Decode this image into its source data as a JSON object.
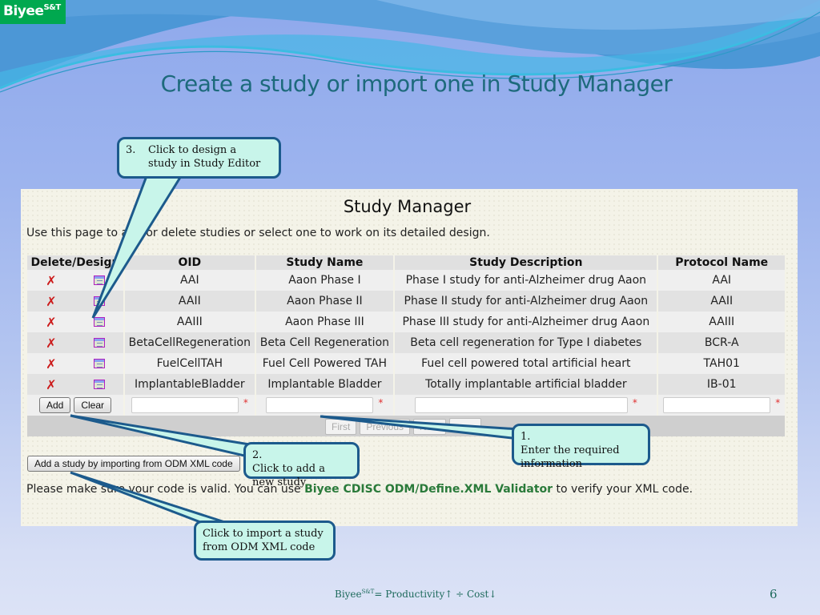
{
  "logo": {
    "name": "Biyee",
    "superscript": "S&T"
  },
  "slide": {
    "title": "Create a study or import one in Study Manager",
    "page_number": "6"
  },
  "footer": {
    "brand": "Biyee",
    "superscript": "S&T",
    "formula": "= Productivity↑ ÷ Cost↓"
  },
  "study_manager": {
    "title": "Study Manager",
    "intro": "Use this page to add or delete studies or select one to work on its detailed design.",
    "columns": [
      "Delete/Design",
      "OID",
      "Study Name",
      "Study Description",
      "Protocol Name"
    ],
    "rows": [
      {
        "oid": "AAI",
        "name": "Aaon Phase I",
        "description": "Phase I study for anti-Alzheimer drug Aaon",
        "protocol": "AAI"
      },
      {
        "oid": "AAII",
        "name": "Aaon Phase II",
        "description": "Phase II study for anti-Alzheimer drug Aaon",
        "protocol": "AAII"
      },
      {
        "oid": "AAIII",
        "name": "Aaon Phase III",
        "description": "Phase III study for anti-Alzheimer drug Aaon",
        "protocol": "AAIII"
      },
      {
        "oid": "BetaCellRegeneration",
        "name": "Beta Cell Regeneration",
        "description": "Beta cell regeneration for Type I diabetes",
        "protocol": "BCR-A"
      },
      {
        "oid": "FuelCellTAH",
        "name": "Fuel Cell Powered TAH",
        "description": "Fuel cell powered total artificial heart",
        "protocol": "TAH01"
      },
      {
        "oid": "ImplantableBladder",
        "name": "Implantable Bladder",
        "description": "Totally implantable artificial bladder",
        "protocol": "IB-01"
      }
    ],
    "icons": {
      "delete": "delete-x-icon",
      "design": "design-study-icon"
    },
    "add_row": {
      "add_label": "Add",
      "clear_label": "Clear",
      "required_marker": "*",
      "oid_value": "",
      "name_value": "",
      "description_value": "",
      "protocol_value": ""
    },
    "pager": {
      "first": "First",
      "previous": "Previous",
      "next": "Next",
      "last": ""
    },
    "import_button": "Add a study by importing from ODM XML code",
    "note_prefix": "Please make sure your code is valid.  You can use ",
    "note_link": "Biyee CDISC ODM/Define.XML Validator",
    "note_suffix": " to verify your XML code."
  },
  "callouts": [
    {
      "num": "1.",
      "text": "Enter the required information"
    },
    {
      "num": "2.",
      "text": "Click to add a new study"
    },
    {
      "num": "3.",
      "text": "Click to design a study in Study Editor"
    },
    {
      "num": "",
      "text": "Click to import a study from ODM XML code"
    }
  ],
  "colors": {
    "logo_bg": "#00a84f",
    "title": "#1d6a7c",
    "callout_fill": "#c8f5ea",
    "callout_border": "#1c5a8c",
    "link": "#2a7a3a",
    "delete": "#cc1a1a"
  }
}
